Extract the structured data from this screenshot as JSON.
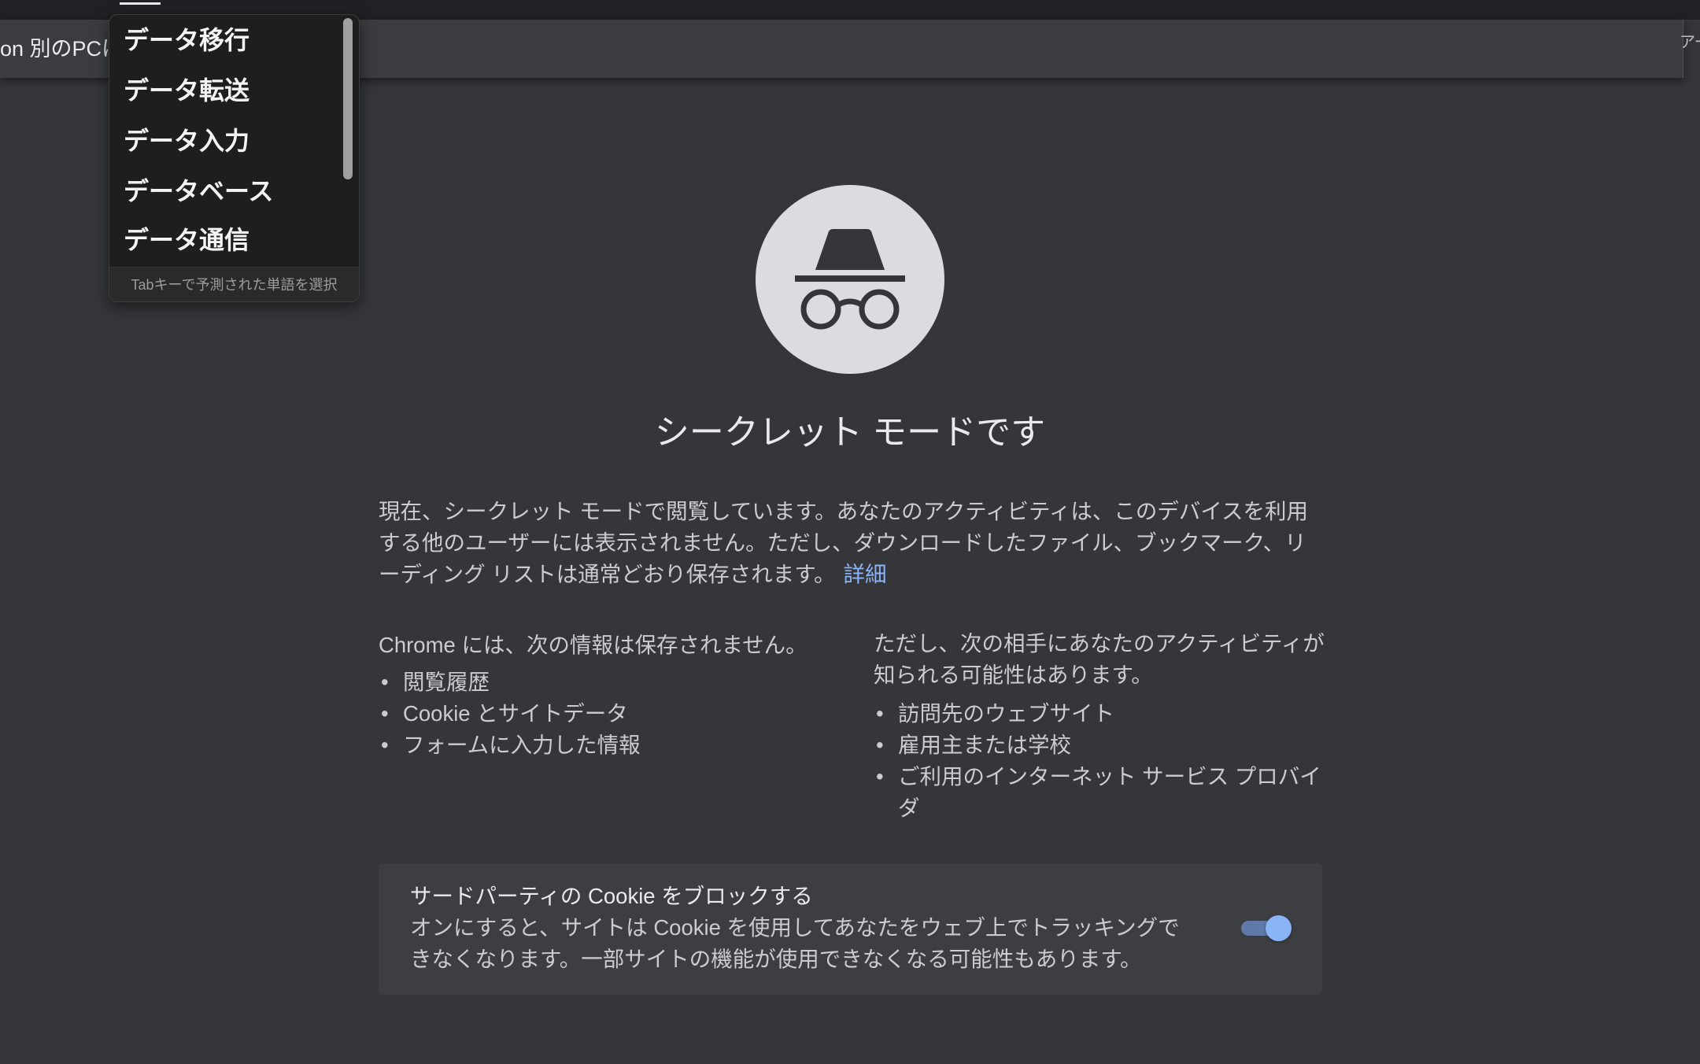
{
  "browser": {
    "suggestion_text": "on 別のPCに",
    "right_edge_text": "アー"
  },
  "ime": {
    "candidates": [
      "データ移行",
      "データ転送",
      "データ入力",
      "データベース",
      "データ通信"
    ],
    "hint": "Tabキーで予測された単語を選択"
  },
  "incognito": {
    "icon": "incognito-icon",
    "title": "シークレット モードです",
    "description": "現在、シークレット モードで閲覧しています。あなたのアクティビティは、このデバイスを利用する他のユーザーには表示されません。ただし、ダウンロードしたファイル、ブックマーク、リーディング リストは通常どおり保存されます。",
    "learn_more": "詳細",
    "not_saved": {
      "heading": "Chrome には、次の情報は保存されません。",
      "items": [
        "閲覧履歴",
        "Cookie とサイトデータ",
        "フォームに入力した情報"
      ]
    },
    "may_be_visible": {
      "heading": "ただし、次の相手にあなたのアクティビティが知られる可能性はあります。",
      "items": [
        "訪問先のウェブサイト",
        "雇用主または学校",
        "ご利用のインターネット サービス プロバイダ"
      ]
    },
    "cookie_controls": {
      "title": "サードパーティの Cookie をブロックする",
      "description": "オンにすると、サイトは Cookie を使用してあなたをウェブ上でトラッキングできなくなります。一部サイトの機能が使用できなくなる可能性もあります。",
      "toggle_on": "true"
    }
  },
  "colors": {
    "background": "#35363a",
    "top_strip": "#202124",
    "accent": "#8ab4f8",
    "text": "#e8eaed",
    "icon_circle": "#dadce0",
    "ime_background": "#1e1e1e"
  }
}
